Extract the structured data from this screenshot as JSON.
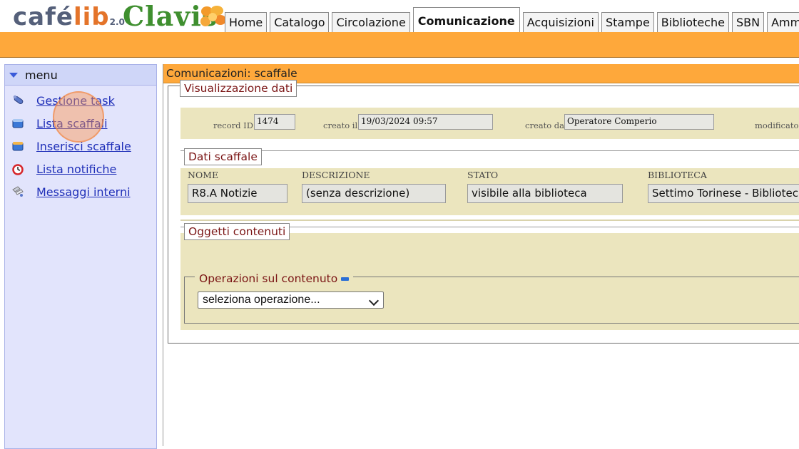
{
  "header": {
    "logo_cafelib": {
      "cafe": "café",
      "lib": "lib",
      "version": "2.0"
    },
    "logo_clavis": "Clavis",
    "tabs": [
      {
        "label": "Home",
        "active": false
      },
      {
        "label": "Catalogo",
        "active": false
      },
      {
        "label": "Circolazione",
        "active": false
      },
      {
        "label": "Comunicazione",
        "active": true
      },
      {
        "label": "Acquisizioni",
        "active": false
      },
      {
        "label": "Stampe",
        "active": false
      },
      {
        "label": "Biblioteche",
        "active": false
      },
      {
        "label": "SBN",
        "active": false
      },
      {
        "label": "Amministr",
        "active": false
      }
    ]
  },
  "sidebar": {
    "title": "menu",
    "items": [
      {
        "label": "Gestione task",
        "icon": "paperclip-icon"
      },
      {
        "label": "Lista scaffali",
        "icon": "shelf-icon"
      },
      {
        "label": "Inserisci scaffale",
        "icon": "add-shelf-icon"
      },
      {
        "label": "Lista notifiche",
        "icon": "alarm-clock-icon"
      },
      {
        "label": "Messaggi interni",
        "icon": "messages-icon"
      }
    ]
  },
  "main": {
    "title": "Comunicazioni: scaffale",
    "visualizzazione": {
      "legend": "Visualizzazione dati",
      "record_id_label": "record ID",
      "record_id": "1474",
      "creato_il_label": "creato il",
      "creato_il": "19/03/2024 09:57",
      "creato_da_label": "creato da",
      "creato_da": "Operatore Comperio",
      "modificato_label": "modificato il"
    },
    "dati_scaffale": {
      "legend": "Dati scaffale",
      "columns": [
        {
          "header": "NOME",
          "value": "R8.A Notizie"
        },
        {
          "header": "DESCRIZIONE",
          "value": "(senza descrizione)"
        },
        {
          "header": "STATO",
          "value": "visibile alla biblioteca"
        },
        {
          "header": "BIBLIOTECA",
          "value": "Settimo Torinese - Biblioteca c"
        }
      ]
    },
    "oggetti": {
      "legend": "Oggetti contenuti",
      "operazioni_legend": "Operazioni sul contenuto",
      "select_value": "seleziona operazione..."
    }
  },
  "colors": {
    "accent_orange": "#fea83b",
    "sidebar_bg": "#e2e4fc",
    "panel_tan": "#ebe5be",
    "link_blue": "#1f2fb8",
    "legend_red": "#7a1414"
  }
}
